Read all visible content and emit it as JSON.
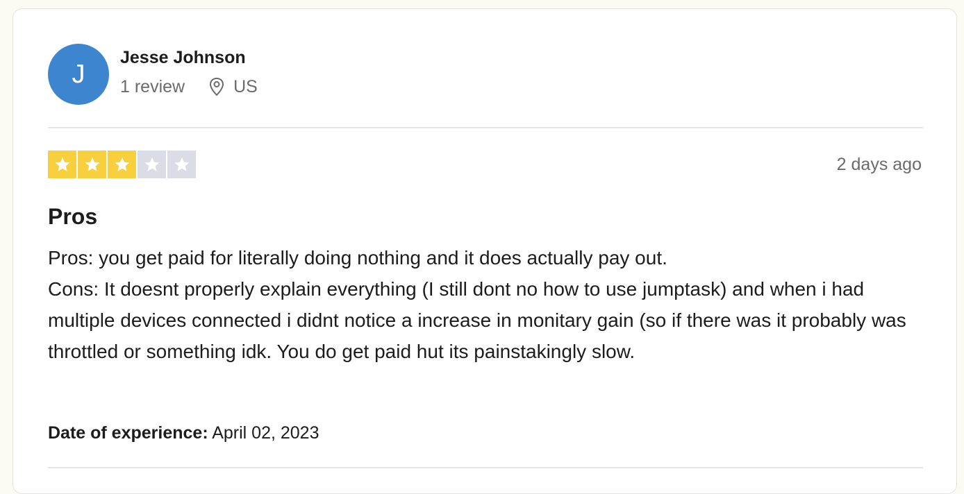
{
  "reviewer": {
    "initial": "J",
    "name": "Jesse Johnson",
    "review_count": "1 review",
    "country": "US",
    "avatar_color": "#3d86cf"
  },
  "review": {
    "rating": 3,
    "max_rating": 5,
    "star_filled_color": "#f8cf3d",
    "star_empty_color": "#dcdce6",
    "time_ago": "2 days ago",
    "title": "Pros",
    "body_lines": [
      "Pros: you get paid for literally doing nothing and it does actually pay out.",
      "Cons: It doesnt properly explain everything (I still dont no how to use jumptask) and when i had multiple devices connected i didnt notice a increase in monitary gain (so if there was it probably was throttled or something idk. You do get paid hut its painstakingly slow."
    ],
    "experience_label": "Date of experience:",
    "experience_date": "April 02, 2023"
  },
  "icons": {
    "location": "location-pin-icon",
    "star": "star-icon"
  }
}
